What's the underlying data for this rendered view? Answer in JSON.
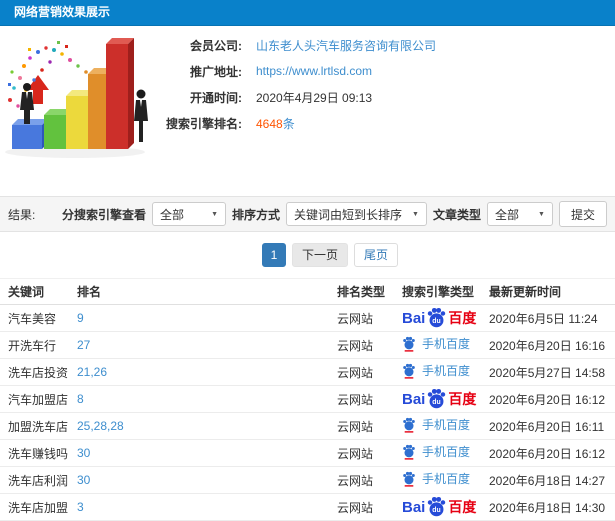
{
  "header": {
    "title": "网络营销效果展示"
  },
  "info": {
    "member_label": "会员公司:",
    "member_value": "山东老人头汽车服务咨询有限公司",
    "url_label": "推广地址:",
    "url_value": "https://www.lrtlsd.com",
    "open_label": "开通时间:",
    "open_value": "2020年4月29日 09:13",
    "rank_label": "搜索引擎排名:",
    "rank_value": "4648",
    "rank_unit": "条"
  },
  "filters": {
    "result_label": "结果:",
    "engine_label": "分搜索引擎查看",
    "engine_value": "全部",
    "sort_label": "排序方式",
    "sort_value": "关键词由短到长排序",
    "article_label": "文章类型",
    "article_value": "全部",
    "submit_label": "提交"
  },
  "pagination": {
    "current": "1",
    "next": "下一页",
    "last": "尾页"
  },
  "table": {
    "headers": [
      "关键词",
      "排名",
      "排名类型",
      "搜索引擎类型",
      "最新更新时间"
    ],
    "engine_labels": {
      "bai": "Bai",
      "du": "du",
      "cn": "百度",
      "mobile": "手机百度"
    },
    "rows": [
      {
        "keyword": "汽车美容",
        "rank": "9",
        "rank_type": "云网站",
        "engine": "baidu",
        "time": "2020年6月5日 11:24"
      },
      {
        "keyword": "开洗车行",
        "rank": "27",
        "rank_type": "云网站",
        "engine": "mobile",
        "time": "2020年6月20日 16:16"
      },
      {
        "keyword": "洗车店投资",
        "rank": "21,26",
        "rank_type": "云网站",
        "engine": "mobile",
        "time": "2020年5月27日 14:58"
      },
      {
        "keyword": "汽车加盟店",
        "rank": "8",
        "rank_type": "云网站",
        "engine": "baidu",
        "time": "2020年6月20日 16:12"
      },
      {
        "keyword": "加盟洗车店",
        "rank": "25,28,28",
        "rank_type": "云网站",
        "engine": "mobile",
        "time": "2020年6月20日 16:11"
      },
      {
        "keyword": "洗车赚钱吗",
        "rank": "30",
        "rank_type": "云网站",
        "engine": "mobile",
        "time": "2020年6月20日 16:12"
      },
      {
        "keyword": "洗车店利润",
        "rank": "30",
        "rank_type": "云网站",
        "engine": "mobile",
        "time": "2020年6月18日 14:27"
      },
      {
        "keyword": "洗车店加盟",
        "rank": "3",
        "rank_type": "云网站",
        "engine": "baidu",
        "time": "2020年6月18日 14:30"
      }
    ]
  },
  "colors": {
    "topbar_bg": "#0981ca",
    "link_blue": "#3e8ece",
    "highlight_orange": "#ff5400",
    "pagination_active": "#337ab7",
    "baidu_blue": "#264bd8",
    "baidu_red": "#e60012",
    "filter_bar_bg": "#f5f5f5"
  }
}
